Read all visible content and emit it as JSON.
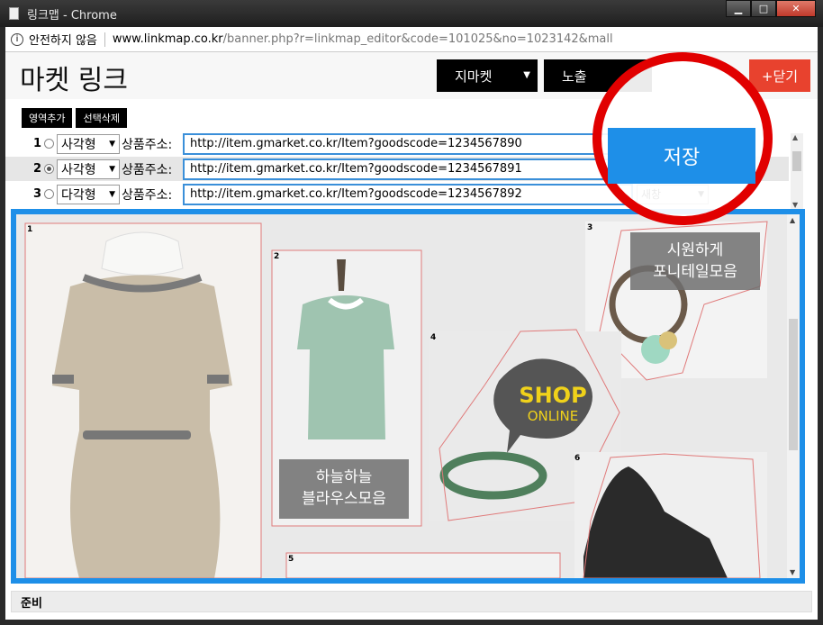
{
  "window": {
    "title": "링크맵 - Chrome"
  },
  "address": {
    "security": "안전하지 않음",
    "host": "www.linkmap.co.kr",
    "path": "/banner.php?r=linkmap_editor&code=101025&no=1023142&mall"
  },
  "header": {
    "title": "마켓 링크",
    "market_select": "지마켓",
    "expose_button": "노출",
    "close_button": "+닫기",
    "save_button": "저장"
  },
  "toolbar": {
    "add_region": "영역추가",
    "delete_selected": "선택삭제"
  },
  "rows": [
    {
      "no": "1",
      "shape": "사각형",
      "label": "상품주소:",
      "url": "http://item.gmarket.co.kr/Item?goodscode=1234567890",
      "selected": false
    },
    {
      "no": "2",
      "shape": "사각형",
      "label": "상품주소:",
      "url": "http://item.gmarket.co.kr/Item?goodscode=1234567891",
      "selected": true
    },
    {
      "no": "3",
      "shape": "다각형",
      "label": "상품주소:",
      "url": "http://item.gmarket.co.kr/Item?goodscode=1234567892",
      "selected": false,
      "target": "새창"
    }
  ],
  "canvas": {
    "regions": [
      "1",
      "2",
      "3",
      "4",
      "5",
      "6"
    ],
    "captions": {
      "ponytail_line1": "시원하게",
      "ponytail_line2": "포니테일모음",
      "blouse_line1": "하늘하늘",
      "blouse_line2": "블라우스모음",
      "shop_line1": "SHOP",
      "shop_line2": "ONLINE"
    }
  },
  "status": {
    "text": "준비"
  },
  "colors": {
    "accent": "#1e8fe8",
    "close": "#e8422e",
    "highlight": "#e10000"
  }
}
